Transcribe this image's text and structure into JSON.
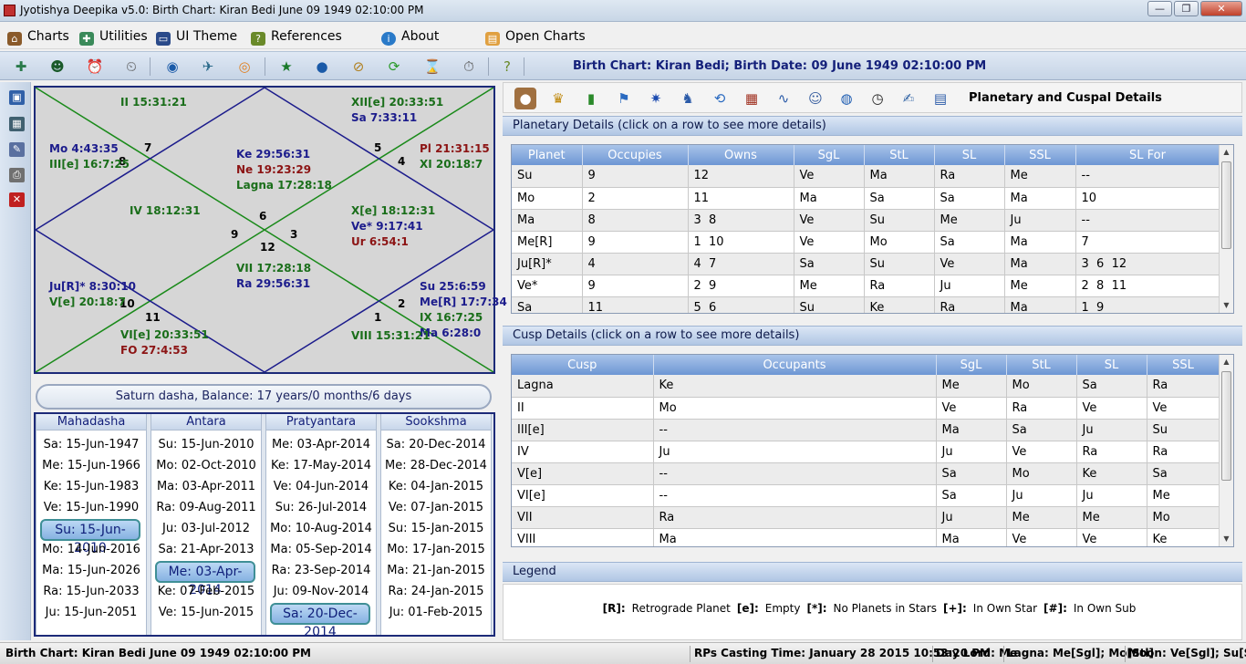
{
  "window": {
    "title": "Jyotishya Deepika v5.0:  Birth Chart: Kiran Bedi June 09 1949 02:10:00 PM",
    "minimize": "—",
    "maximize": "❐",
    "close": "✕"
  },
  "menu": {
    "items": [
      {
        "label": "Charts",
        "icon": "home-icon"
      },
      {
        "label": "Utilities",
        "icon": "tools-icon"
      },
      {
        "label": "UI Theme",
        "icon": "monitor-icon"
      },
      {
        "label": "References",
        "icon": "book-icon"
      },
      {
        "label": "About",
        "icon": "info-icon"
      },
      {
        "label": "Open Charts",
        "icon": "open-folder-icon"
      }
    ]
  },
  "toolbar": {
    "title": "Birth Chart: Kiran Bedi; Birth Date: 09 June 1949 02:10:00 PM"
  },
  "chart": {
    "houses": {
      "h7": "7",
      "h8": "8",
      "h5": "5",
      "h4": "4",
      "h6": "6",
      "h9": "9",
      "h12": "12",
      "h3": "3",
      "h11": "11",
      "h10": "10",
      "h2": "2",
      "h1": "1"
    },
    "top_left": [
      "II 15:31:21"
    ],
    "top_right": [
      "XII[e] 20:33:51",
      "Sa 7:33:11"
    ],
    "left_upper": [
      "Mo 4:43:35",
      "III[e] 16:7:25"
    ],
    "center_top": [
      "Ke 29:56:31",
      "Ne 19:23:29",
      "Lagna 17:28:18"
    ],
    "right_upper": [
      "Pl 21:31:15",
      "XI 20:18:7"
    ],
    "left_mid": [
      "IV 18:12:31"
    ],
    "right_mid": [
      "X[e] 18:12:31",
      "Ve* 9:17:41",
      "Ur 6:54:1"
    ],
    "center_bottom": [
      "VII 17:28:18",
      "Ra 29:56:31"
    ],
    "left_lower": [
      "Ju[R]* 8:30:10",
      "V[e] 20:18:7"
    ],
    "right_lower": [
      "Su 25:6:59",
      "Me[R] 17:7:34",
      "IX 16:7:25",
      "Ma 6:28:0"
    ],
    "bottom_left": [
      "VI[e] 20:33:51",
      "FO 27:4:53"
    ],
    "bottom_right": [
      "VIII 15:31:21"
    ]
  },
  "dasha_balance": "Saturn dasha, Balance: 17 years/0 months/6 days",
  "dasha": {
    "columns": [
      {
        "title": "Mahadasha",
        "rows": [
          "Sa: 15-Jun-1947",
          "Me: 15-Jun-1966",
          "Ke: 15-Jun-1983",
          "Ve: 15-Jun-1990",
          "Su: 15-Jun-2010",
          "Mo: 14-Jun-2016",
          "Ma: 15-Jun-2026",
          "Ra: 15-Jun-2033",
          "Ju: 15-Jun-2051"
        ],
        "selected": 4
      },
      {
        "title": "Antara",
        "rows": [
          "Su: 15-Jun-2010",
          "Mo: 02-Oct-2010",
          "Ma: 03-Apr-2011",
          "Ra: 09-Aug-2011",
          "Ju: 03-Jul-2012",
          "Sa: 21-Apr-2013",
          "Me: 03-Apr-2014",
          "Ke: 07-Feb-2015",
          "Ve: 15-Jun-2015"
        ],
        "selected": 6
      },
      {
        "title": "Pratyantara",
        "rows": [
          "Me: 03-Apr-2014",
          "Ke: 17-May-2014",
          "Ve: 04-Jun-2014",
          "Su: 26-Jul-2014",
          "Mo: 10-Aug-2014",
          "Ma: 05-Sep-2014",
          "Ra: 23-Sep-2014",
          "Ju: 09-Nov-2014",
          "Sa: 20-Dec-2014"
        ],
        "selected": 8
      },
      {
        "title": "Sookshma",
        "rows": [
          "Sa: 20-Dec-2014",
          "Me: 28-Dec-2014",
          "Ke: 04-Jan-2015",
          "Ve: 07-Jan-2015",
          "Su: 15-Jan-2015",
          "Mo: 17-Jan-2015",
          "Ma: 21-Jan-2015",
          "Ra: 24-Jan-2015",
          "Ju: 01-Feb-2015"
        ],
        "selected": -1
      }
    ]
  },
  "right": {
    "title": "Planetary and Cuspal Details",
    "planetary_header": "Planetary Details (click on a row to see more details)",
    "planetary": {
      "columns": [
        "Planet",
        "Occupies",
        "Owns",
        "SgL",
        "StL",
        "SL",
        "SSL",
        "SL For"
      ],
      "rows": [
        [
          "Su",
          "9",
          "12",
          "Ve",
          "Ma",
          "Ra",
          "Me",
          "--"
        ],
        [
          "Mo",
          "2",
          "11",
          "Ma",
          "Sa",
          "Sa",
          "Ma",
          "10"
        ],
        [
          "Ma",
          "8",
          "3  8",
          "Ve",
          "Su",
          "Me",
          "Ju",
          "--"
        ],
        [
          "Me[R]",
          "9",
          "1  10",
          "Ve",
          "Mo",
          "Sa",
          "Ma",
          "7"
        ],
        [
          "Ju[R]*",
          "4",
          "4  7",
          "Sa",
          "Su",
          "Ve",
          "Ma",
          "3  6  12"
        ],
        [
          "Ve*",
          "9",
          "2  9",
          "Me",
          "Ra",
          "Ju",
          "Me",
          "2  8  11"
        ],
        [
          "Sa",
          "11",
          "5  6",
          "Su",
          "Ke",
          "Ra",
          "Ma",
          "1  9"
        ]
      ]
    },
    "cusp_header": "Cusp Details (click on a row to see more details)",
    "cusp": {
      "columns": [
        "Cusp",
        "Occupants",
        "SgL",
        "StL",
        "SL",
        "SSL"
      ],
      "rows": [
        [
          "Lagna",
          "Ke",
          "Me",
          "Mo",
          "Sa",
          "Ra"
        ],
        [
          "II",
          "Mo",
          "Ve",
          "Ra",
          "Ve",
          "Ve"
        ],
        [
          "III[e]",
          "--",
          "Ma",
          "Sa",
          "Ju",
          "Su"
        ],
        [
          "IV",
          "Ju",
          "Ju",
          "Ve",
          "Ra",
          "Ra"
        ],
        [
          "V[e]",
          "--",
          "Sa",
          "Mo",
          "Ke",
          "Sa"
        ],
        [
          "VI[e]",
          "--",
          "Sa",
          "Ju",
          "Ju",
          "Me"
        ],
        [
          "VII",
          "Ra",
          "Ju",
          "Me",
          "Me",
          "Mo"
        ],
        [
          "VIII",
          "Ma",
          "Ma",
          "Ve",
          "Ve",
          "Ke"
        ]
      ]
    },
    "legend_header": "Legend",
    "legend": [
      {
        "key": "[R]:",
        "text": "Retrograde Planet"
      },
      {
        "key": "[e]:",
        "text": "Empty"
      },
      {
        "key": "[*]:",
        "text": "No Planets in Stars"
      },
      {
        "key": "[+]:",
        "text": "In Own Star"
      },
      {
        "key": "[#]:",
        "text": "In Own Sub"
      }
    ]
  },
  "status": {
    "chart": "Birth Chart: Kiran Bedi June 09 1949 02:10:00 PM",
    "rps_time": "RPs Casting Time: January 28 2015 10:53:20 PM",
    "day_lord": "Day Lord: Me",
    "lagna": "Lagna: Me[Sgl]; Mo[Stl]",
    "moon": "Moon: Ve[Sgl]; Su[Stl]"
  },
  "colors": {
    "chart_border": "#1c2a78",
    "green_line": "#1a8a1a",
    "navy_line": "#1c1c8c",
    "header_blue": "#6d96d4"
  }
}
